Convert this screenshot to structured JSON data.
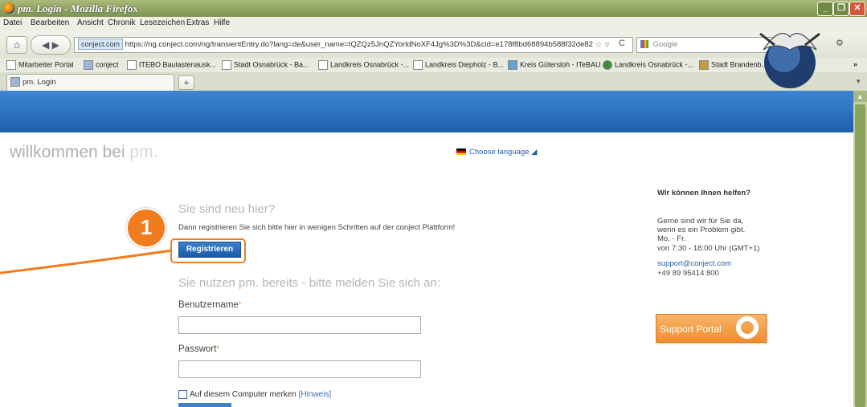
{
  "window": {
    "title": "pm. Login - Mozilla Firefox"
  },
  "menu": [
    "Datei",
    "Bearbeiten",
    "Ansicht",
    "Chronik",
    "Lesezeichen",
    "Extras",
    "Hilfe"
  ],
  "nav": {
    "site_badge": "conject.com",
    "url": "https://ng.conject.com/ng/transientEntry.do?lang=de&user_name=tQZQz5JnQZYorldNoXF4Jg%3D%3D&cid=e178f8bd68894b588f32de82",
    "search_placeholder": "Google"
  },
  "bookmarks": [
    "Mitarbeiter Portal",
    "conject",
    "ITEBO Baulastenausk...",
    "Stadt Osnabrück - Ba...",
    "Landkreis Osnabrück -...",
    "Landkreis Diepholz - B...",
    "Kreis Gütersloh - ITeBAU",
    "Landkreis Osnabrück -...",
    "Stadt Brandenb..."
  ],
  "tab": {
    "label": "pm. Login"
  },
  "page": {
    "welcome": "willkommen bei",
    "welcome_brand": "pm.",
    "choose_language": "Choose language ◢",
    "new_heading": "Sie sind neu hier?",
    "new_sub": "Dann registrieren Sie sich bitte hier in wenigen Schritten auf der conject Plattform!",
    "register_label": "Registrieren",
    "step_number": "1",
    "login_heading": "Sie nutzen pm. bereits - bitte melden Sie sich an:",
    "username_label": "Benutzername",
    "password_label": "Passwort",
    "required_mark": "*",
    "remember_label": "Auf diesem Computer merken",
    "hint_label": "[Hinweis]"
  },
  "help": {
    "title": "Wir können Ihnen helfen?",
    "lines": [
      "Gerne sind wir für Sie da,",
      "wenn es ein Problem gibt.",
      "Mo. - Fr.",
      "von 7:30 - 18:00 Uhr (GMT+1)"
    ],
    "email": "support@conject.com",
    "phone": "+49 89 95414 800",
    "support_portal": "Support Portal"
  },
  "colors": {
    "accent_orange": "#f07c1d",
    "header_blue": "#1e5fae",
    "window_green": "#7d9650"
  }
}
